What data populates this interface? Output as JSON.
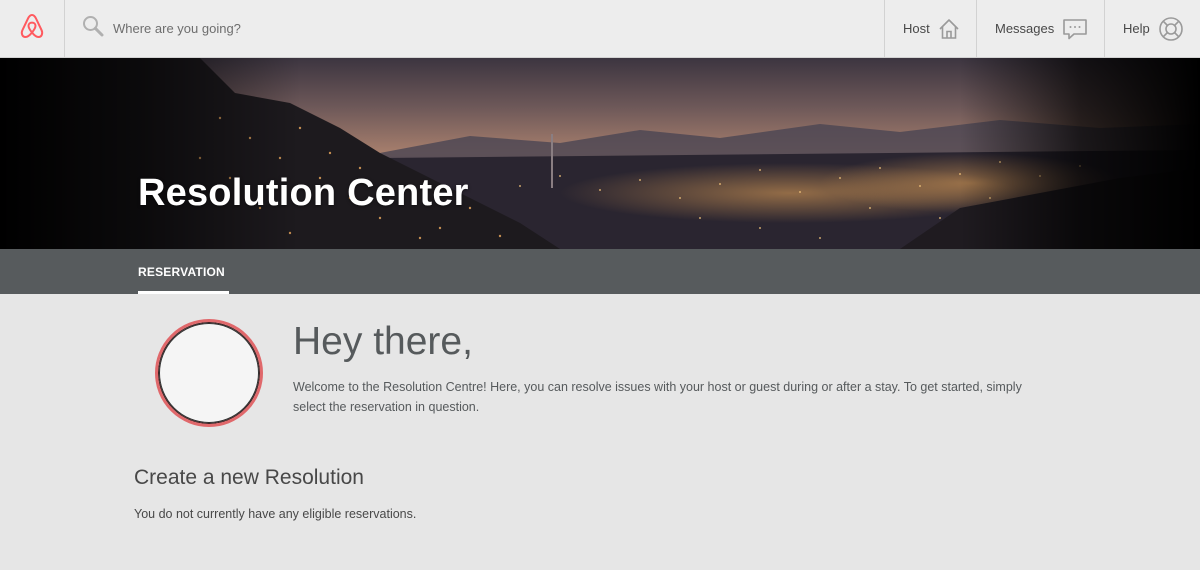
{
  "topnav": {
    "logo_icon": "airbnb-logo-icon",
    "search_icon": "search-icon",
    "search_placeholder": "Where are you going?",
    "host_label": "Host",
    "host_icon": "house-icon",
    "messages_label": "Messages",
    "messages_icon": "chat-bubble-icon",
    "help_label": "Help",
    "help_icon": "lifebuoy-icon"
  },
  "hero": {
    "title": "Resolution Center"
  },
  "subnav": {
    "tabs": [
      {
        "label": "RESERVATION",
        "active": true
      }
    ]
  },
  "main": {
    "greeting": "Hey there,",
    "welcome_text": "Welcome to the Resolution Centre! Here, you can resolve issues with your host or guest during or after a stay. To get started, simply select the reservation in question.",
    "section_title": "Create a new Resolution",
    "empty_note": "You do not currently have any eligible reservations."
  },
  "colors": {
    "brand": "#ff5a5f",
    "subnav_bg": "#575b5d",
    "page_bg": "#e6e6e6"
  }
}
